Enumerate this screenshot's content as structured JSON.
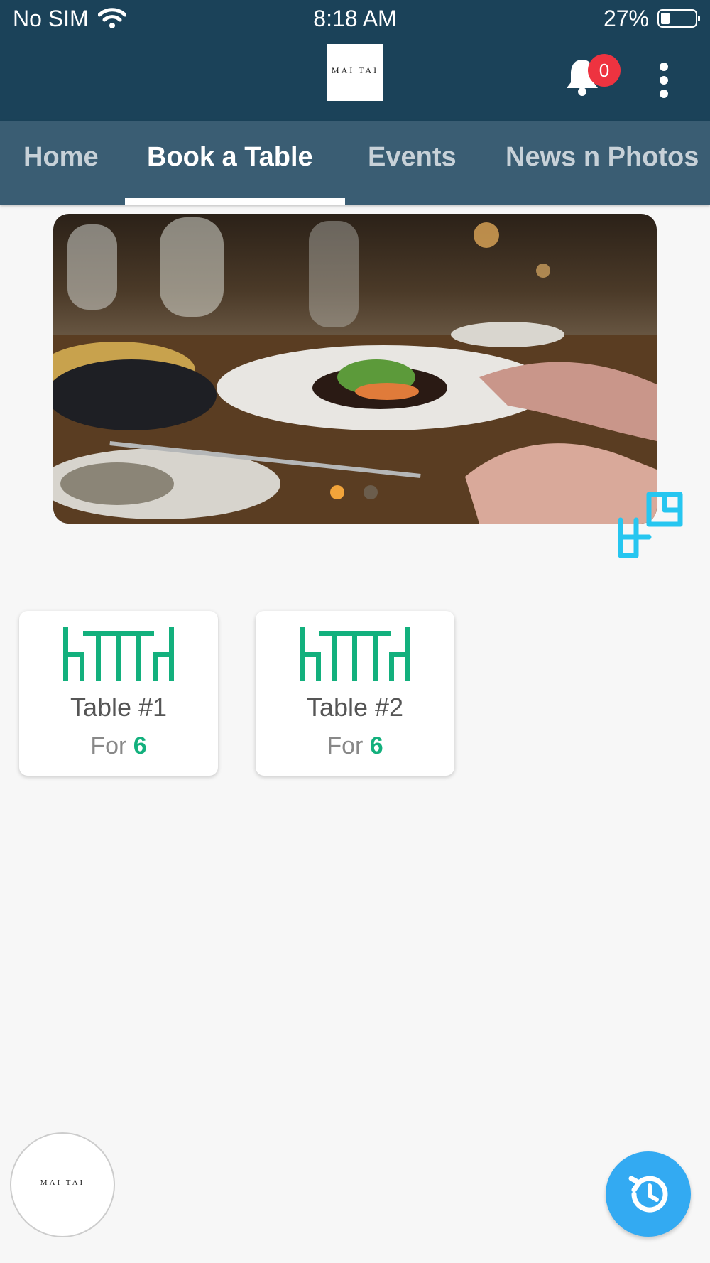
{
  "status_bar": {
    "carrier": "No SIM",
    "time": "8:18 AM",
    "battery_percent": "27%",
    "battery_level": 0.27,
    "icons": [
      "wifi-icon",
      "battery-icon"
    ]
  },
  "header": {
    "logo_text": "MAI TAI",
    "notification_count": "0",
    "icons": [
      "bell-icon",
      "more-vertical-icon"
    ],
    "colors": {
      "header_bg": "#1b4259",
      "badge": "#ee3340"
    }
  },
  "tabs": [
    {
      "label": "Home",
      "active": false
    },
    {
      "label": "Book a Table",
      "active": true
    },
    {
      "label": "Events",
      "active": false
    },
    {
      "label": "News n Photos",
      "active": false
    }
  ],
  "carousel": {
    "slides": 2,
    "active_slide": 1,
    "image_subject": "restaurant-dining-table-photo"
  },
  "tables": [
    {
      "name": "Table #1",
      "for_label": "For",
      "seats": "6"
    },
    {
      "name": "Table #2",
      "for_label": "For",
      "seats": "6"
    }
  ],
  "fabs": {
    "logo_text": "MAI TAI",
    "icons": [
      "ar-view-icon",
      "history-icon"
    ],
    "colors": {
      "history_fab": "#33aaf2",
      "accent_green": "#13b07d"
    }
  }
}
